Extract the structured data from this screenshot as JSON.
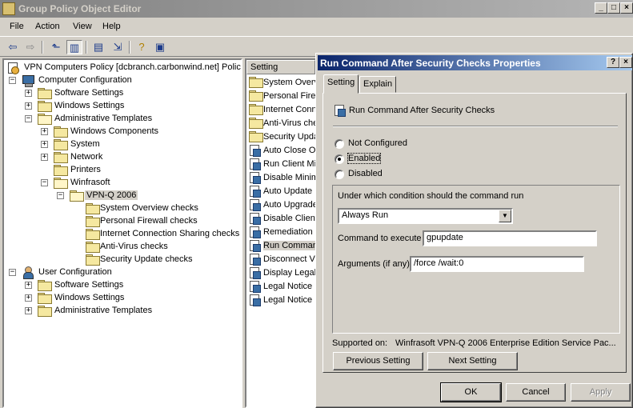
{
  "window": {
    "title": "Group Policy Object Editor",
    "minimize": "_",
    "maximize": "□",
    "close": "×"
  },
  "menu": {
    "file": "File",
    "action": "Action",
    "view": "View",
    "help": "Help"
  },
  "tree": {
    "root": "VPN Computers Policy [dcbranch.carbonwind.net] Policy",
    "computer_configuration": "Computer Configuration",
    "cc_software_settings": "Software Settings",
    "cc_windows_settings": "Windows Settings",
    "cc_administrative_templates": "Administrative Templates",
    "windows_components": "Windows Components",
    "system": "System",
    "network": "Network",
    "printers": "Printers",
    "winfrasoft": "Winfrasoft",
    "vpnq": "VPN-Q 2006",
    "system_overview_checks": "System Overview checks",
    "personal_firewall_checks": "Personal Firewall checks",
    "ics_checks": "Internet Connection Sharing checks",
    "antivirus_checks": "Anti-Virus checks",
    "security_update_checks": "Security Update checks",
    "user_configuration": "User Configuration",
    "uc_software_settings": "Software Settings",
    "uc_windows_settings": "Windows Settings",
    "uc_administrative_templates": "Administrative Templates"
  },
  "list": {
    "header": "Setting",
    "items": [
      "System Overv",
      "Personal Fire",
      "Internet Conn",
      "Anti-Virus che",
      "Security Upda",
      "Auto Close O",
      "Run Client Mi",
      "Disable Minim",
      "Auto Update",
      "Auto Upgrade",
      "Disable Client",
      "Remediation",
      "Run Comman",
      "Disconnect VI",
      "Display Legal",
      "Legal Notice r",
      "Legal Notice r"
    ]
  },
  "dialog": {
    "title": "Run Command After Security Checks Properties",
    "help_btn": "?",
    "close_btn": "×",
    "tab_setting": "Setting",
    "tab_explain": "Explain",
    "policy_name": "Run Command After Security Checks",
    "radio_not_configured": "Not Configured",
    "radio_enabled": "Enabled",
    "radio_disabled": "Disabled",
    "condition_label": "Under which condition should the command run",
    "condition_value": "Always Run",
    "command_label": "Command to execute",
    "command_value": "gpupdate",
    "arguments_label": "Arguments (if any)",
    "arguments_value": "/force /wait:0",
    "supported_label": "Supported on:",
    "supported_value": "Winfrasoft VPN-Q 2006 Enterprise Edition Service Pac...",
    "previous_setting": "Previous Setting",
    "next_setting": "Next Setting",
    "ok": "OK",
    "cancel": "Cancel",
    "apply": "Apply"
  }
}
